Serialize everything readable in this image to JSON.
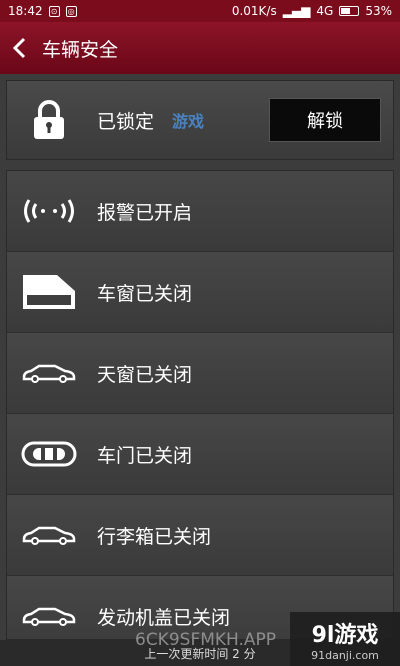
{
  "status_bar": {
    "time": "18:42",
    "network_speed": "0.01K/s",
    "network": "4G",
    "battery": "53%"
  },
  "nav": {
    "back_icon": "chevron-left-icon",
    "title": "车辆安全"
  },
  "lock_panel": {
    "label": "已锁定",
    "button_label": "解锁",
    "watermark": "游戏"
  },
  "status_items": [
    {
      "label": "报警已开启",
      "icon": "alarm-signal-icon"
    },
    {
      "label": "车窗已关闭",
      "icon": "window-icon"
    },
    {
      "label": "天窗已关闭",
      "icon": "car-sunroof-icon"
    },
    {
      "label": "车门已关闭",
      "icon": "car-door-icon"
    },
    {
      "label": "行李箱已关闭",
      "icon": "car-trunk-icon"
    },
    {
      "label": "发动机盖已关闭",
      "icon": "car-hood-icon"
    }
  ],
  "footer": {
    "text": "上一次更新时间 2 分",
    "overlay_text": "6CK9SFMKH.APP"
  },
  "logo": {
    "main": "9l游戏",
    "sub": "91danji.com"
  }
}
